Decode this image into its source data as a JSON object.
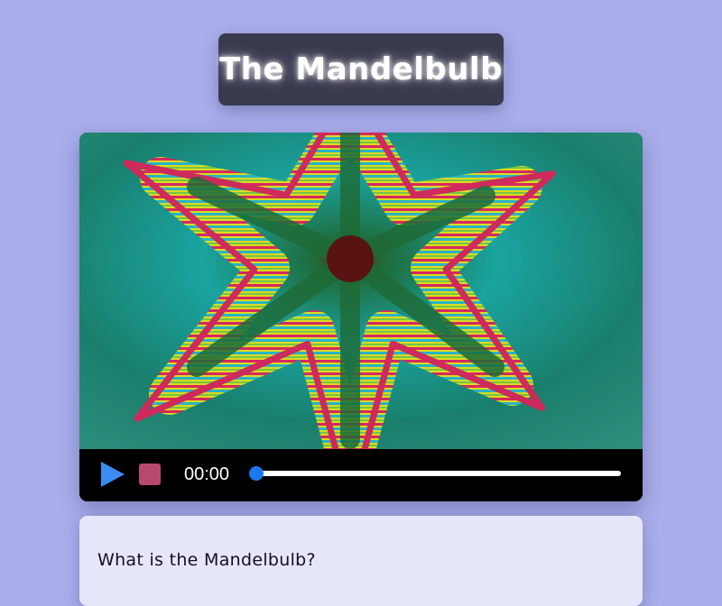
{
  "header": {
    "title": "The Mandelbulb"
  },
  "player": {
    "play_icon": "play-icon",
    "stop_icon": "stop-icon",
    "current_time": "00:00",
    "progress": 0,
    "colors": {
      "play": "#3a8cf2",
      "stop": "#b9496c",
      "seek_thumb": "#1a79f0"
    }
  },
  "info": {
    "heading": "What is the Mandelbulb?"
  }
}
